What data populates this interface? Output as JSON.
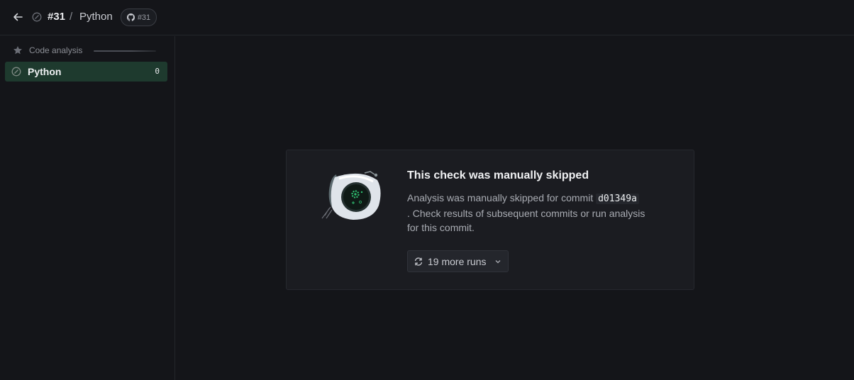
{
  "header": {
    "run_number": "#31",
    "separator": "/",
    "analyzer_name": "Python",
    "github_badge": "#31"
  },
  "sidebar": {
    "section_label": "Code analysis",
    "items": [
      {
        "label": "Python",
        "count": "0"
      }
    ]
  },
  "main": {
    "title": "This check was manually skipped",
    "desc_prefix": "Analysis was manually skipped for commit",
    "commit_sha": "d01349a",
    "desc_suffix": ". Check results of subsequent commits or run analysis for this commit.",
    "runs_button": "19 more runs"
  },
  "colors": {
    "background": "#141519",
    "selected_item": "#1e3a2e",
    "accent_green": "#2fbf71"
  },
  "icons": [
    "back-arrow-icon",
    "skipped-status-icon",
    "github-icon",
    "star-icon",
    "refresh-icon",
    "chevron-down-icon",
    "robot-illustration"
  ]
}
